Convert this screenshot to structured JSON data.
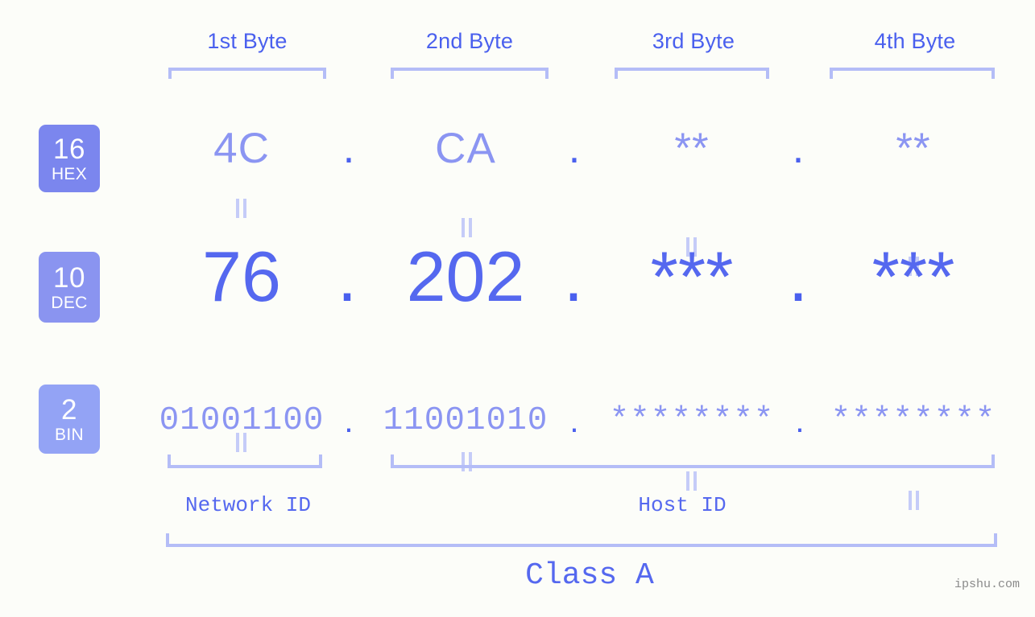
{
  "page": {
    "background_color": "#fcfdf9",
    "accent_color": "#5568ef",
    "light_accent_color": "#8b95f2",
    "bracket_color": "#b4bdf7",
    "watermark": "ipshu.com"
  },
  "byte_headers": [
    {
      "label": "1st Byte"
    },
    {
      "label": "2nd Byte"
    },
    {
      "label": "3rd Byte"
    },
    {
      "label": "4th Byte"
    }
  ],
  "rows": {
    "hex": {
      "badge_number": "16",
      "badge_system": "HEX",
      "badge_color": "#7b86ee",
      "values": [
        "4C",
        "CA",
        "**",
        "**"
      ],
      "separator": "."
    },
    "dec": {
      "badge_number": "10",
      "badge_system": "DEC",
      "badge_color": "#8a94f0",
      "values": [
        "76",
        "202",
        "***",
        "***"
      ],
      "separator": "."
    },
    "bin": {
      "badge_number": "2",
      "badge_system": "BIN",
      "badge_color": "#93a3f5",
      "values": [
        "01001100",
        "11001010",
        "********",
        "********"
      ],
      "separator": "."
    }
  },
  "equals_symbol": "||",
  "footer": {
    "network_id_label": "Network ID",
    "host_id_label": "Host ID",
    "class_label": "Class A"
  }
}
